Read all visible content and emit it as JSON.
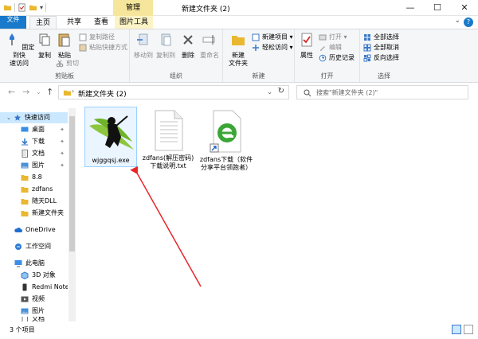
{
  "titlebar": {
    "context_tab": "管理",
    "title": "新建文件夹 (2)",
    "minimize": "—",
    "maximize": "☐",
    "close": "✕"
  },
  "ribbon_tabs": {
    "file": "文件",
    "home": "主页",
    "share": "共享",
    "view": "查看",
    "picture_tools": "图片工具",
    "help": "?"
  },
  "clipboard": {
    "pin_quick_access": "固定到快\n速访问",
    "copy": "复制",
    "paste": "粘贴",
    "copy_path": "复制路径",
    "paste_shortcut": "粘贴快捷方式",
    "cut": "剪切",
    "label": "剪贴板"
  },
  "organize": {
    "move_to": "移动到",
    "copy_to": "复制到",
    "delete": "删除",
    "rename": "重命名",
    "label": "组织"
  },
  "new": {
    "new_folder": "新建\n文件夹",
    "new_item": "新建项目 ▾",
    "easy_access": "轻松访问 ▾",
    "label": "新建"
  },
  "open": {
    "properties": "属性",
    "open": "打开 ▾",
    "edit": "编辑",
    "history": "历史记录",
    "label": "打开"
  },
  "select": {
    "select_all": "全部选择",
    "select_none": "全部取消",
    "invert": "反向选择",
    "label": "选择"
  },
  "address": {
    "path": "新建文件夹 (2)",
    "search_placeholder": "搜索\"新建文件夹 (2)\""
  },
  "nav": {
    "quick_access": "快速访问",
    "desktop": "桌面",
    "downloads": "下载",
    "documents": "文档",
    "pictures": "图片",
    "f88": "8.8",
    "zdfans": "zdfans",
    "suitiandll": "随天DLL",
    "newfolder": "新建文件夹",
    "onedrive": "OneDrive",
    "workspace": "工作空间",
    "thispc": "此电脑",
    "obj3d": "3D 对象",
    "redmi": "Redmi Note",
    "videos": "视频",
    "pictures2": "图片",
    "documents2": "文档"
  },
  "files": [
    {
      "name": "wjggqsj.exe"
    },
    {
      "name": "zdfans(解压密码)下载说明.txt"
    },
    {
      "name": "zdfans下载（软件分享平台领跑者）"
    }
  ],
  "status": {
    "count": "3 个项目"
  },
  "colors": {
    "accent": "#1979ca",
    "selection": "#cce8ff",
    "context_tab": "#f6e69b",
    "arrow": "#e8262a"
  }
}
